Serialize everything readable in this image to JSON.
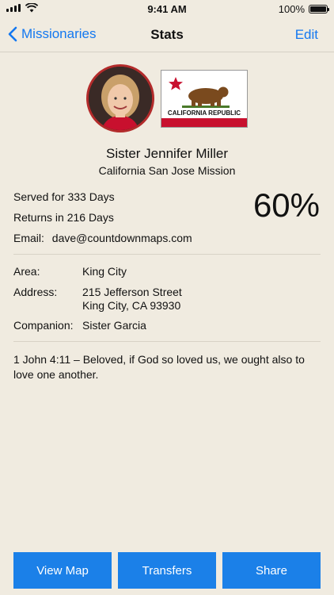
{
  "status_bar": {
    "time": "9:41 AM",
    "battery": "100%"
  },
  "nav": {
    "back_label": "Missionaries",
    "title": "Stats",
    "edit_label": "Edit"
  },
  "profile": {
    "photo_icon": "missionary-photo",
    "flag": {
      "banner_text": "CALIFORNIA REPUBLIC"
    },
    "name": "Sister Jennifer Miller",
    "mission": "California San Jose Mission"
  },
  "stats": {
    "served": "Served for 333 Days",
    "returns": "Returns in 216 Days",
    "email_label": "Email:",
    "email": "dave@countdownmaps.com",
    "percent": "60%",
    "progress_fraction": 0.6
  },
  "details": {
    "area_label": "Area:",
    "area": "King City",
    "address_label": "Address:",
    "address_line1": "215 Jefferson Street",
    "address_line2": "King City, CA 93930",
    "companion_label": "Companion:",
    "companion": "Sister Garcia"
  },
  "quote": "1 John 4:11 – Beloved, if God so loved us, we ought also to love one another.",
  "buttons": {
    "view_map": "View Map",
    "transfers": "Transfers",
    "share": "Share"
  },
  "colors": {
    "accent": "#1478f0",
    "button_bg": "#1b80e8",
    "background": "#f0ebe0",
    "photo_border": "#b32b2b"
  }
}
